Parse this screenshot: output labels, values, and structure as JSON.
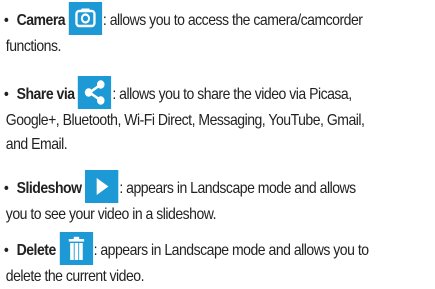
{
  "bullet": "•",
  "items": [
    {
      "term": "Camera",
      "icon": "camera-switch-icon",
      "line1": ": allows you to access the camera/camcorder",
      "line2": "functions."
    },
    {
      "term": "Share via",
      "icon": "share-icon",
      "line1": ": allows you to share the video via Picasa,",
      "line2": "Google+, Bluetooth, Wi-Fi Direct, Messaging, YouTube, Gmail,",
      "line3": "and Email."
    },
    {
      "term": "Slideshow",
      "icon": "play-icon",
      "line1": ": appears in Landscape mode and allows",
      "line2": "you to see your video in a slideshow."
    },
    {
      "term": "Delete",
      "icon": "trash-icon",
      "line1": ": appears in Landscape mode and allows you to",
      "line2": "delete the current video."
    }
  ],
  "colors": {
    "icon_background": "#1d9ad6",
    "icon_foreground": "#ffffff",
    "text": "#222222"
  }
}
